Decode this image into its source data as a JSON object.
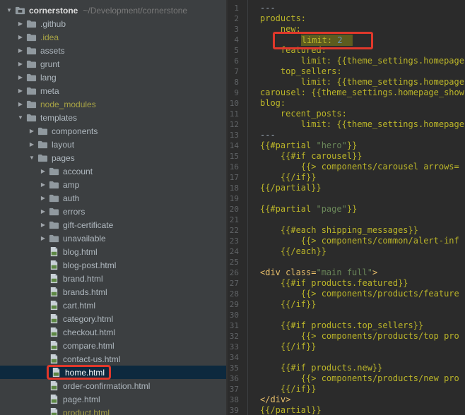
{
  "colors": {
    "annotation_red": "#e0382b",
    "selection_blue": "#0d293e",
    "highlight_olive": "#5d5c1f",
    "tree_bg": "#3c3f41",
    "editor_bg": "#2b2b2b"
  },
  "tree": {
    "items": [
      {
        "label": "cornerstone",
        "path": "~/Development/cornerstone",
        "level": 0,
        "icon": "project",
        "arrow": "down"
      },
      {
        "label": ".github",
        "level": 1,
        "icon": "folder",
        "arrow": "right"
      },
      {
        "label": ".idea",
        "level": 1,
        "icon": "folder",
        "arrow": "right",
        "excluded": true
      },
      {
        "label": "assets",
        "level": 1,
        "icon": "folder",
        "arrow": "right"
      },
      {
        "label": "grunt",
        "level": 1,
        "icon": "folder",
        "arrow": "right"
      },
      {
        "label": "lang",
        "level": 1,
        "icon": "folder",
        "arrow": "right"
      },
      {
        "label": "meta",
        "level": 1,
        "icon": "folder",
        "arrow": "right"
      },
      {
        "label": "node_modules",
        "level": 1,
        "icon": "folder",
        "arrow": "right",
        "excluded": true
      },
      {
        "label": "templates",
        "level": 1,
        "icon": "folder",
        "arrow": "down"
      },
      {
        "label": "components",
        "level": 2,
        "icon": "folder",
        "arrow": "right"
      },
      {
        "label": "layout",
        "level": 2,
        "icon": "folder",
        "arrow": "right"
      },
      {
        "label": "pages",
        "level": 2,
        "icon": "folder",
        "arrow": "down"
      },
      {
        "label": "account",
        "level": 3,
        "icon": "folder",
        "arrow": "right"
      },
      {
        "label": "amp",
        "level": 3,
        "icon": "folder",
        "arrow": "right"
      },
      {
        "label": "auth",
        "level": 3,
        "icon": "folder",
        "arrow": "right"
      },
      {
        "label": "errors",
        "level": 3,
        "icon": "folder",
        "arrow": "right"
      },
      {
        "label": "gift-certificate",
        "level": 3,
        "icon": "folder",
        "arrow": "right"
      },
      {
        "label": "unavailable",
        "level": 3,
        "icon": "folder",
        "arrow": "right"
      },
      {
        "label": "blog.html",
        "level": 3,
        "icon": "html",
        "arrow": "none"
      },
      {
        "label": "blog-post.html",
        "level": 3,
        "icon": "html",
        "arrow": "none"
      },
      {
        "label": "brand.html",
        "level": 3,
        "icon": "html",
        "arrow": "none"
      },
      {
        "label": "brands.html",
        "level": 3,
        "icon": "html",
        "arrow": "none"
      },
      {
        "label": "cart.html",
        "level": 3,
        "icon": "html",
        "arrow": "none"
      },
      {
        "label": "category.html",
        "level": 3,
        "icon": "html",
        "arrow": "none"
      },
      {
        "label": "checkout.html",
        "level": 3,
        "icon": "html",
        "arrow": "none"
      },
      {
        "label": "compare.html",
        "level": 3,
        "icon": "html",
        "arrow": "none"
      },
      {
        "label": "contact-us.html",
        "level": 3,
        "icon": "html",
        "arrow": "none"
      },
      {
        "label": "home.html",
        "level": 3,
        "icon": "html",
        "arrow": "none",
        "selected": true,
        "annotated": true
      },
      {
        "label": "order-confirmation.html",
        "level": 3,
        "icon": "html",
        "arrow": "none"
      },
      {
        "label": "page.html",
        "level": 3,
        "icon": "html",
        "arrow": "none"
      },
      {
        "label": "product.html",
        "level": 3,
        "icon": "html",
        "arrow": "none",
        "excluded": true
      }
    ]
  },
  "editor": {
    "lines": [
      {
        "n": 1,
        "seg": [
          [
            "---",
            "p"
          ]
        ]
      },
      {
        "n": 2,
        "seg": [
          [
            "products:",
            "k"
          ]
        ]
      },
      {
        "n": 3,
        "seg": [
          [
            "    ",
            "p"
          ],
          [
            "new:",
            "k"
          ]
        ]
      },
      {
        "n": 4,
        "indent": "        ",
        "boxed": [
          [
            "limit: ",
            "k"
          ],
          [
            "2",
            "n"
          ]
        ]
      },
      {
        "n": 5,
        "seg": [
          [
            "    ",
            "p"
          ],
          [
            "featured:",
            "k"
          ]
        ]
      },
      {
        "n": 6,
        "seg": [
          [
            "        ",
            "p"
          ],
          [
            "limit: {{theme_settings.homepage",
            "k"
          ]
        ]
      },
      {
        "n": 7,
        "seg": [
          [
            "    ",
            "p"
          ],
          [
            "top_sellers:",
            "k"
          ]
        ]
      },
      {
        "n": 8,
        "seg": [
          [
            "        ",
            "p"
          ],
          [
            "limit: {{theme_settings.homepage",
            "k"
          ]
        ]
      },
      {
        "n": 9,
        "seg": [
          [
            "carousel: {{theme_settings.homepage_show",
            "k"
          ]
        ]
      },
      {
        "n": 10,
        "seg": [
          [
            "blog:",
            "k"
          ]
        ]
      },
      {
        "n": 11,
        "seg": [
          [
            "    ",
            "p"
          ],
          [
            "recent_posts:",
            "k"
          ]
        ]
      },
      {
        "n": 12,
        "seg": [
          [
            "        ",
            "p"
          ],
          [
            "limit: {{theme_settings.homepage",
            "k"
          ]
        ]
      },
      {
        "n": 13,
        "seg": [
          [
            "---",
            "p"
          ]
        ]
      },
      {
        "n": 14,
        "seg": [
          [
            "{{#partial ",
            "k"
          ],
          [
            "\"hero\"",
            "s"
          ],
          [
            "}}",
            "k"
          ]
        ]
      },
      {
        "n": 15,
        "seg": [
          [
            "    ",
            "p"
          ],
          [
            "{{#if carousel}}",
            "k"
          ]
        ]
      },
      {
        "n": 16,
        "seg": [
          [
            "        ",
            "p"
          ],
          [
            "{{> components/carousel arrows=",
            "k"
          ]
        ]
      },
      {
        "n": 17,
        "seg": [
          [
            "    ",
            "p"
          ],
          [
            "{{/if}}",
            "k"
          ]
        ]
      },
      {
        "n": 18,
        "seg": [
          [
            "{{/partial}}",
            "k"
          ]
        ]
      },
      {
        "n": 19,
        "seg": []
      },
      {
        "n": 20,
        "seg": [
          [
            "{{#partial ",
            "k"
          ],
          [
            "\"page\"",
            "s"
          ],
          [
            "}}",
            "k"
          ]
        ]
      },
      {
        "n": 21,
        "seg": []
      },
      {
        "n": 22,
        "seg": [
          [
            "    ",
            "p"
          ],
          [
            "{{#each shipping_messages}}",
            "k"
          ]
        ]
      },
      {
        "n": 23,
        "seg": [
          [
            "        ",
            "p"
          ],
          [
            "{{> components/common/alert-inf",
            "k"
          ]
        ]
      },
      {
        "n": 24,
        "seg": [
          [
            "    ",
            "p"
          ],
          [
            "{{/each}}",
            "k"
          ]
        ]
      },
      {
        "n": 25,
        "seg": []
      },
      {
        "n": 26,
        "seg": [
          [
            "<div ",
            "t"
          ],
          [
            "class=",
            "t"
          ],
          [
            "\"main full\"",
            "s"
          ],
          [
            ">",
            "t"
          ]
        ]
      },
      {
        "n": 27,
        "seg": [
          [
            "    ",
            "p"
          ],
          [
            "{{#if products.featured}}",
            "k"
          ]
        ]
      },
      {
        "n": 28,
        "seg": [
          [
            "        ",
            "p"
          ],
          [
            "{{> components/products/feature",
            "k"
          ]
        ]
      },
      {
        "n": 29,
        "seg": [
          [
            "    ",
            "p"
          ],
          [
            "{{/if}}",
            "k"
          ]
        ]
      },
      {
        "n": 30,
        "seg": []
      },
      {
        "n": 31,
        "seg": [
          [
            "    ",
            "p"
          ],
          [
            "{{#if products.top_sellers}}",
            "k"
          ]
        ]
      },
      {
        "n": 32,
        "seg": [
          [
            "        ",
            "p"
          ],
          [
            "{{> components/products/top pro",
            "k"
          ]
        ]
      },
      {
        "n": 33,
        "seg": [
          [
            "    ",
            "p"
          ],
          [
            "{{/if}}",
            "k"
          ]
        ]
      },
      {
        "n": 34,
        "seg": []
      },
      {
        "n": 35,
        "seg": [
          [
            "    ",
            "p"
          ],
          [
            "{{#if products.new}}",
            "k"
          ]
        ]
      },
      {
        "n": 36,
        "seg": [
          [
            "        ",
            "p"
          ],
          [
            "{{> components/products/new pro",
            "k"
          ]
        ]
      },
      {
        "n": 37,
        "seg": [
          [
            "    ",
            "p"
          ],
          [
            "{{/if}}",
            "k"
          ]
        ]
      },
      {
        "n": 38,
        "seg": [
          [
            "</div>",
            "t"
          ]
        ]
      },
      {
        "n": 39,
        "seg": [
          [
            "{{/partial}}",
            "k"
          ]
        ]
      }
    ]
  }
}
